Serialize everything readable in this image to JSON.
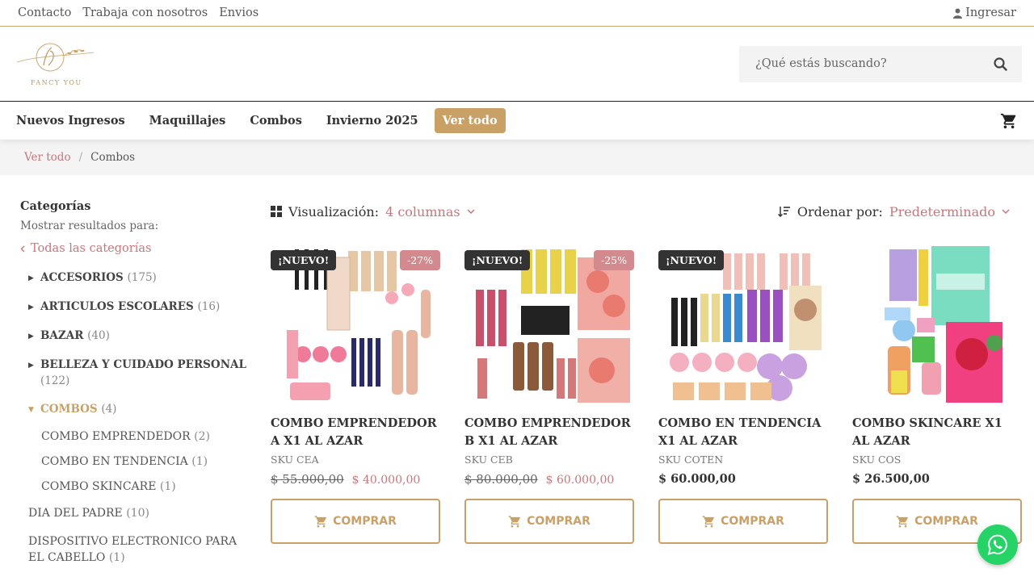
{
  "topbar": {
    "links": [
      "Contacto",
      "Trabaja con nosotros",
      "Envios"
    ],
    "login": "Ingresar"
  },
  "logo": {
    "text": "FANCY YOU"
  },
  "search": {
    "placeholder": "¿Qué estás buscando?"
  },
  "nav": {
    "items": [
      "Nuevos Ingresos",
      "Maquillajes",
      "Combos",
      "Invierno 2025"
    ],
    "highlight": "Ver todo"
  },
  "breadcrumb": {
    "root": "Ver todo",
    "sep": "/",
    "current": "Combos"
  },
  "sidebar": {
    "title": "Categorías",
    "subtitle": "Mostrar resultados para:",
    "all": "Todas las categorías",
    "categories": [
      {
        "name": "ACCESORIOS",
        "count": "(175)"
      },
      {
        "name": "ARTICULOS ESCOLARES",
        "count": "(16)"
      },
      {
        "name": "BAZAR",
        "count": "(40)"
      },
      {
        "name": "BELLEZA Y CUIDADO PERSONAL",
        "count": "(122)"
      },
      {
        "name": "COMBOS",
        "count": "(4)"
      }
    ],
    "subcategories": [
      {
        "name": "COMBO EMPRENDEDOR",
        "count": "(2)"
      },
      {
        "name": "COMBO EN TENDENCIA",
        "count": "(1)"
      },
      {
        "name": "COMBO SKINCARE",
        "count": "(1)"
      }
    ],
    "others": [
      {
        "name": "DIA DEL PADRE",
        "count": "(10)"
      },
      {
        "name": "DISPOSITIVO ELECTRONICO PARA EL CABELLO",
        "count": "(1)"
      }
    ]
  },
  "toolbar": {
    "view_label": "Visualización:",
    "view_value": "4 columnas",
    "sort_label": "Ordenar por:",
    "sort_value": "Predeterminado"
  },
  "products": [
    {
      "title": "COMBO EMPRENDEDOR A X1 AL AZAR",
      "sku": "SKU CEA",
      "badge": "¡NUEVO!",
      "discount": "-27%",
      "old_price": "$ 55.000,00",
      "price": "$ 40.000,00",
      "button": "COMPRAR"
    },
    {
      "title": "COMBO EMPRENDEDOR B X1 AL AZAR",
      "sku": "SKU CEB",
      "badge": "¡NUEVO!",
      "discount": "-25%",
      "old_price": "$ 80.000,00",
      "price": "$ 60.000,00",
      "button": "COMPRAR"
    },
    {
      "title": "COMBO EN TENDENCIA X1 AL AZAR",
      "sku": "SKU COTEN",
      "badge": "¡NUEVO!",
      "discount": "",
      "old_price": "",
      "price": "$ 60.000,00",
      "button": "COMPRAR"
    },
    {
      "title": "COMBO SKINCARE X1 AL AZAR",
      "sku": "SKU COS",
      "badge": "",
      "discount": "",
      "old_price": "",
      "price": "$ 26.500,00",
      "button": "COMPRAR"
    }
  ],
  "colors": {
    "gold": "#c9a066",
    "rose": "#c7777c",
    "whatsapp": "#25d366"
  }
}
